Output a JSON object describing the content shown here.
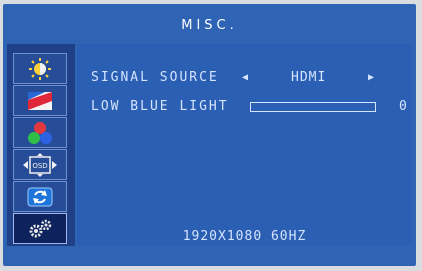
{
  "menu": {
    "title": "MISC.",
    "sidebar": {
      "items": [
        {
          "icon": "brightness-icon"
        },
        {
          "icon": "picture-icon"
        },
        {
          "icon": "color-icon"
        },
        {
          "icon": "osd-icon",
          "label": "OSD"
        },
        {
          "icon": "reset-icon"
        },
        {
          "icon": "misc-gear-icon",
          "selected": true
        }
      ]
    },
    "signal_source": {
      "label": "SIGNAL SOURCE",
      "left_arrow": "◀",
      "value": "HDMI",
      "right_arrow": "▶"
    },
    "low_blue_light": {
      "label": "LOW BLUE LIGHT",
      "level_percent": 0,
      "value": "0"
    },
    "resolution": "1920X1080  60HZ"
  }
}
